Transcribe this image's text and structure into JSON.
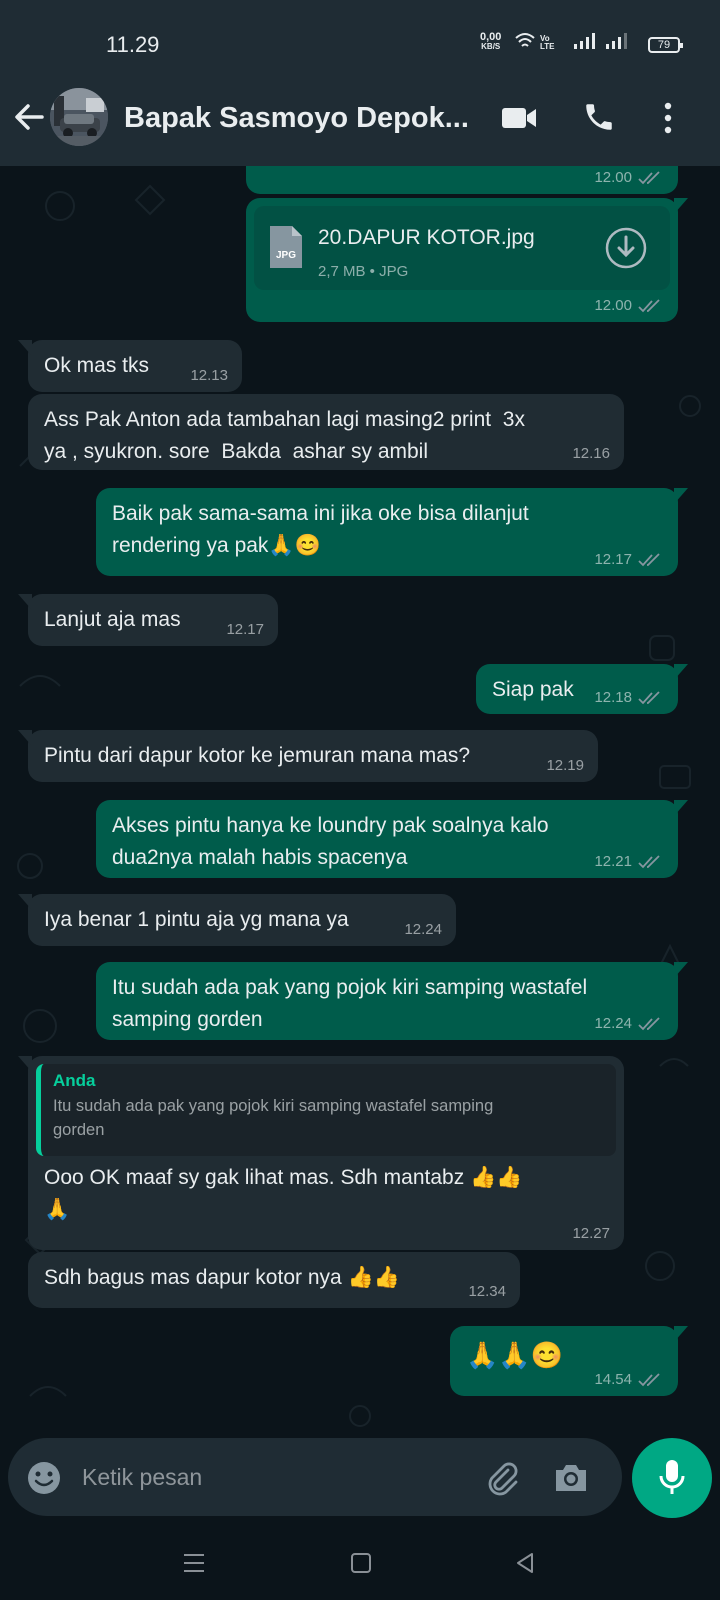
{
  "status_bar": {
    "time": "11.29",
    "net_speed": "0,00",
    "net_unit": "KB/S",
    "volte": "Vo LTE",
    "battery": "79"
  },
  "header": {
    "contact_name": "Bapak Sasmoyo Depok...",
    "back_icon": "arrow-left-icon",
    "video_icon": "video-call-icon",
    "call_icon": "phone-icon",
    "menu_icon": "more-vertical-icon"
  },
  "messages": [
    {
      "dir": "out",
      "time": "12.00",
      "read": true
    },
    {
      "dir": "out",
      "type": "file",
      "file_name": "20.DAPUR KOTOR.jpg",
      "file_meta": "2,7 MB • JPG",
      "file_type": "JPG",
      "time": "12.00",
      "read": true
    },
    {
      "dir": "in",
      "text": "Ok mas tks",
      "time": "12.13"
    },
    {
      "dir": "in",
      "text": "Ass Pak Anton ada tambahan lagi masing2 print  3x\nya , syukron. sore  Bakda  ashar sy ambil",
      "time": "12.16"
    },
    {
      "dir": "out",
      "text": "Baik pak sama-sama ini jika oke bisa dilanjut\nrendering ya pak🙏😊",
      "time": "12.17",
      "read": true
    },
    {
      "dir": "in",
      "text": "Lanjut aja mas",
      "time": "12.17"
    },
    {
      "dir": "out",
      "text": "Siap pak",
      "time": "12.18",
      "read": true
    },
    {
      "dir": "in",
      "text": "Pintu dari dapur kotor ke jemuran mana mas?",
      "time": "12.19"
    },
    {
      "dir": "out",
      "text": "Akses pintu hanya ke loundry pak soalnya kalo\ndua2nya malah habis spacenya",
      "time": "12.21",
      "read": true
    },
    {
      "dir": "in",
      "text": "Iya benar 1 pintu aja yg mana ya",
      "time": "12.24"
    },
    {
      "dir": "out",
      "text": "Itu sudah ada pak yang pojok kiri samping wastafel\nsamping gorden",
      "time": "12.24",
      "read": true
    },
    {
      "dir": "in",
      "quote_name": "Anda",
      "quote_text": "Itu sudah ada pak yang pojok kiri samping wastafel samping\ngorden",
      "text": "Ooo OK maaf sy gak lihat mas. Sdh mantabz 👍👍\n🙏",
      "time": "12.27"
    },
    {
      "dir": "in",
      "text": "Sdh bagus mas dapur kotor nya 👍👍",
      "time": "12.34"
    },
    {
      "dir": "out",
      "text": "🙏🙏😊",
      "time": "14.54",
      "read": true
    }
  ],
  "input": {
    "placeholder": "Ketik pesan",
    "emoji_icon": "emoji-icon",
    "attach_icon": "paperclip-icon",
    "camera_icon": "camera-icon",
    "mic_icon": "microphone-icon"
  },
  "nav": {
    "menu_icon": "recent-apps-icon",
    "home_icon": "home-icon",
    "back_icon": "back-triangle-icon"
  },
  "colors": {
    "bg": "#0b141a",
    "header": "#1f2c34",
    "incoming": "#202c33",
    "outgoing": "#005c4b",
    "accent": "#00a884",
    "read_tick": "#8696a0"
  }
}
